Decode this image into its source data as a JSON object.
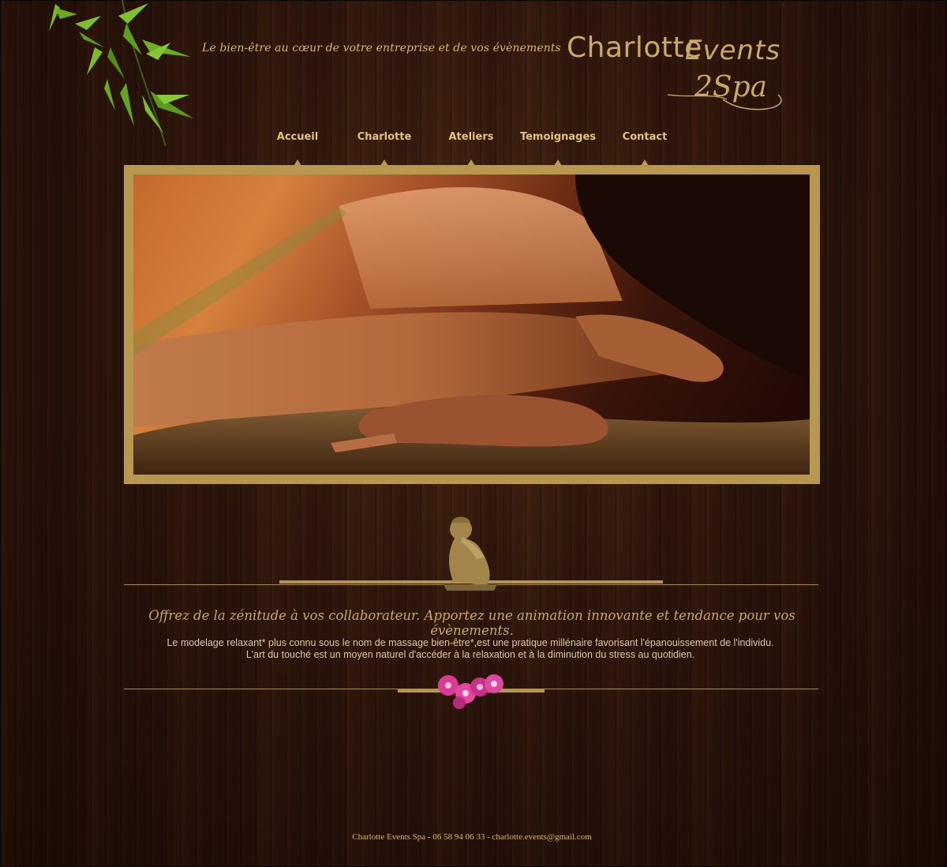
{
  "header": {
    "tagline": "Le bien-être au cœur de votre entreprise et de vos évènements",
    "logo": {
      "part1": "Charlotte",
      "part2": "Events",
      "part3": "2Spa"
    }
  },
  "nav": {
    "items": [
      {
        "label": "Accueil"
      },
      {
        "label": "Charlotte"
      },
      {
        "label": "Ateliers"
      },
      {
        "label": "Temoignages"
      },
      {
        "label": "Contact"
      }
    ]
  },
  "main": {
    "headline": "Offrez de la zénitude à vos collaborateur. Apportez une animation innovante et tendance pour vos évènements.",
    "body_line1": "Le modelage relaxant* plus connu sous le nom de massage bien-être*,est une pratique millénaire favorisant l'épanouissement de l'individu.",
    "body_line2": "L'art du touché est un moyen naturel d'accéder à la relaxation et à la diminution du stress au quotidien."
  },
  "footer": {
    "text": "Charlotte Events Spa - 06 58 94 06 33 - charlotte.events@gmail.com"
  },
  "colors": {
    "gold": "#c9a966",
    "frame": "#b8984f",
    "background": "#241208",
    "orchid": "#e0459e"
  },
  "icons": [
    "bamboo-leaves",
    "buddha-statue",
    "orchid-flower"
  ]
}
